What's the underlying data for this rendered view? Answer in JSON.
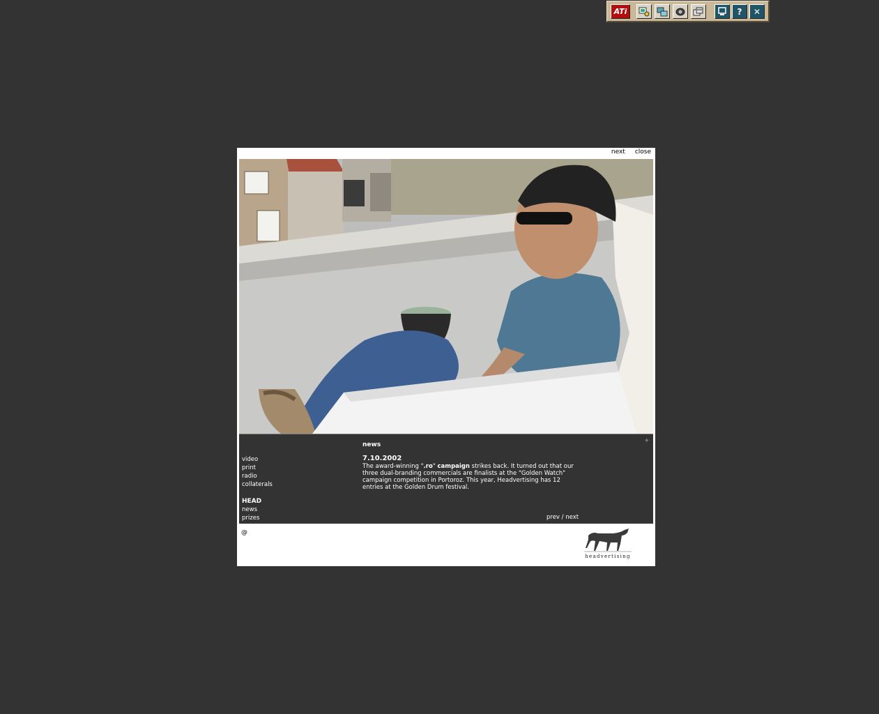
{
  "taskbar": {
    "logo_text": "ATi",
    "help_label": "?",
    "close_label": "✕"
  },
  "frame": {
    "next_label": "next",
    "close_label": "close"
  },
  "menu": {
    "items": [
      "video",
      "print",
      "radio",
      "collaterals"
    ],
    "head_label": "HEAD",
    "head_items": [
      "news",
      "prizes"
    ]
  },
  "news": {
    "title": "news",
    "date": "7.10.2002",
    "body_pre": "The award-winning \"",
    "body_bold1": ".ro",
    "body_mid": "\" ",
    "body_bold2": "campaign",
    "body_post": " strikes back. It turned out that our three dual-branding commercials are finalists at the \"Golden Watch\" campaign competition in Portoroz. This year, Headvertising has 12 entries at the Golden Drum festival.",
    "prev_label": "prev",
    "separator": " / ",
    "next_label": "next"
  },
  "footer": {
    "at_symbol": "@",
    "logo_text": "headvertising"
  }
}
